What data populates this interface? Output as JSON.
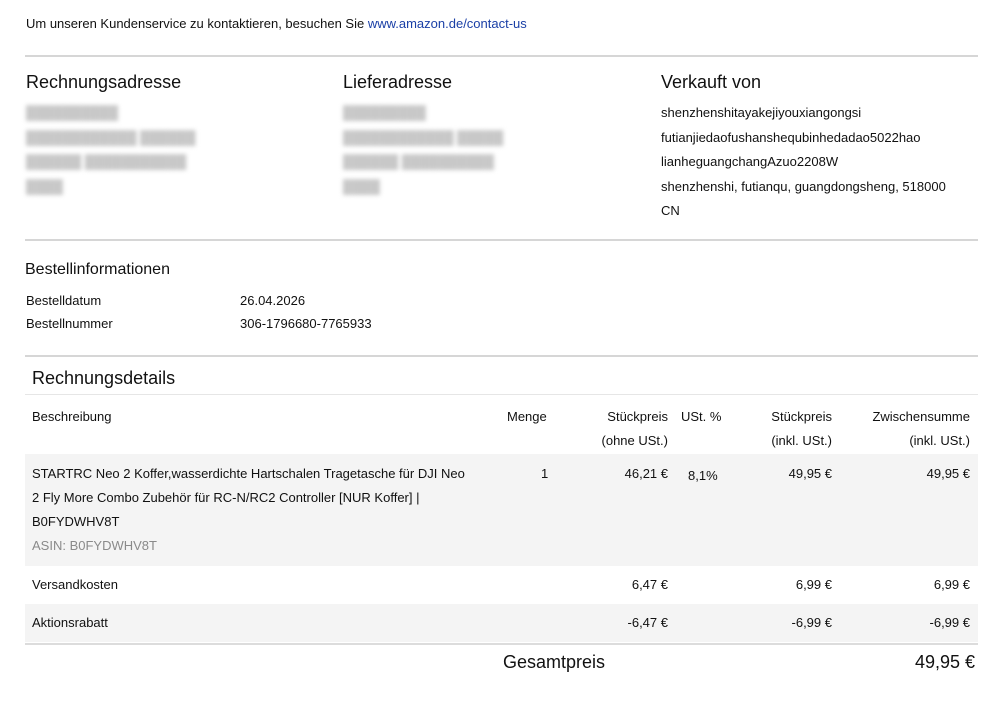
{
  "contact": {
    "text": "Um unseren Kundenservice zu kontaktieren, besuchen Sie ",
    "link": "www.amazon.de/contact-us"
  },
  "billing": {
    "title": "Rechnungsadresse",
    "lines": [
      "██████████",
      "████████████ ██████",
      "██████ ███████████",
      "████"
    ]
  },
  "delivery": {
    "title": "Lieferadresse",
    "lines": [
      "█████████",
      "████████████ █████",
      "██████ ██████████",
      "████"
    ]
  },
  "seller": {
    "title": "Verkauft von",
    "lines": [
      "shenzhenshitayakejiyouxiangongsi",
      "futianjiedaofushanshequbinhedadao5022hao",
      "lianheguangchangAzuo2208W",
      "shenzhenshi, futianqu, guangdongsheng, 518000",
      "CN"
    ]
  },
  "order_info": {
    "title": "Bestellinformationen",
    "date_label": "Bestelldatum",
    "date_value": "26.04.2026",
    "number_label": "Bestellnummer",
    "number_value": "306-1796680-7765933"
  },
  "details": {
    "title": "Rechnungsdetails",
    "headers": {
      "description": "Beschreibung",
      "quantity": "Menge",
      "unit_price_line1": "Stückpreis",
      "unit_price_line2": "(ohne USt.)",
      "vat": "USt. %",
      "unit_price_incl_line1": "Stückpreis",
      "unit_price_incl_line2": "(inkl. USt.)",
      "subtotal_line1": "Zwischensumme",
      "subtotal_line2": "(inkl. USt.)"
    },
    "item": {
      "desc_line1": "STARTRC Neo 2 Koffer,wasserdichte Hartschalen Tragetasche für DJI Neo",
      "desc_line2": "2 Fly More Combo Zubehör für RC-N/RC2 Controller [NUR Koffer] |",
      "desc_line3": "B0FYDWHV8T",
      "asin": "ASIN: B0FYDWHV8T",
      "quantity": "1",
      "unit_price": "46,21 €",
      "vat": "8,1%",
      "unit_price_incl": "49,95 €",
      "subtotal": "49,95 €"
    },
    "shipping": {
      "label": "Versandkosten",
      "unit_price": "6,47 €",
      "unit_price_incl": "6,99 €",
      "subtotal": "6,99 €"
    },
    "discount": {
      "label": "Aktionsrabatt",
      "unit_price": "-6,47 €",
      "unit_price_incl": "-6,99 €",
      "subtotal": "-6,99 €"
    },
    "total_label": "Gesamtpreis",
    "total_value": "49,95 €"
  }
}
